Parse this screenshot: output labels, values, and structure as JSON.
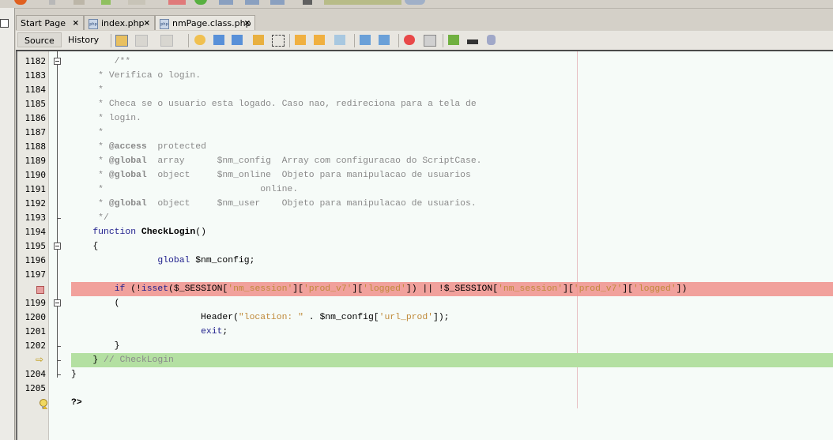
{
  "tabs": [
    {
      "label": "Start Page",
      "close": "×",
      "has_icon": false
    },
    {
      "label": "index.php",
      "close": "×",
      "has_icon": true
    },
    {
      "label": "nmPage.class.php",
      "close": "×",
      "has_icon": true,
      "active": true
    }
  ],
  "php_icon_text": "php",
  "editor_toolbar": {
    "source_label": "Source",
    "history_label": "History",
    "icons": [
      "last-edit-icon",
      "back-icon",
      "forward-icon",
      "find-selection-icon",
      "find-previous-icon",
      "find-next-icon",
      "toggle-highlight-icon",
      "toggle-rect-selection-icon",
      "previous-bookmark-icon",
      "next-bookmark-icon",
      "toggle-bookmark-icon",
      "shift-left-icon",
      "shift-right-icon",
      "start-macro-icon",
      "stop-macro-icon",
      "comment-icon",
      "uncomment-icon",
      "database-icon"
    ]
  },
  "lines": [
    {
      "num": "1182",
      "marker": "",
      "tokens": [
        {
          "t": "        /**",
          "c": "cm"
        }
      ]
    },
    {
      "num": "1183",
      "marker": "",
      "tokens": [
        {
          "t": "     * Verifica o login.",
          "c": "cm"
        }
      ]
    },
    {
      "num": "1184",
      "marker": "",
      "tokens": [
        {
          "t": "     *",
          "c": "cm"
        }
      ]
    },
    {
      "num": "1185",
      "marker": "",
      "tokens": [
        {
          "t": "     * Checa se o usuario esta logado. Caso nao, redireciona para a tela de",
          "c": "cm"
        }
      ]
    },
    {
      "num": "1186",
      "marker": "",
      "tokens": [
        {
          "t": "     * login.",
          "c": "cm"
        }
      ]
    },
    {
      "num": "1187",
      "marker": "",
      "tokens": [
        {
          "t": "     *",
          "c": "cm"
        }
      ]
    },
    {
      "num": "1188",
      "marker": "",
      "tokens": [
        {
          "t": "     * ",
          "c": "cm"
        },
        {
          "t": "@access",
          "c": "cmb"
        },
        {
          "t": "  protected",
          "c": "cm"
        }
      ]
    },
    {
      "num": "1189",
      "marker": "",
      "tokens": [
        {
          "t": "     * ",
          "c": "cm"
        },
        {
          "t": "@global",
          "c": "cmb"
        },
        {
          "t": "  array      $nm_config  Array com configuracao do ScriptCase.",
          "c": "cm"
        }
      ]
    },
    {
      "num": "1190",
      "marker": "",
      "tokens": [
        {
          "t": "     * ",
          "c": "cm"
        },
        {
          "t": "@global",
          "c": "cmb"
        },
        {
          "t": "  object     $nm_online  Objeto para manipulacao de usuarios",
          "c": "cm"
        }
      ]
    },
    {
      "num": "1191",
      "marker": "",
      "tokens": [
        {
          "t": "     *                             online.",
          "c": "cm"
        }
      ]
    },
    {
      "num": "1192",
      "marker": "",
      "tokens": [
        {
          "t": "     * ",
          "c": "cm"
        },
        {
          "t": "@global",
          "c": "cmb"
        },
        {
          "t": "  object     $nm_user    Objeto para manipulacao de usuarios.",
          "c": "cm"
        }
      ]
    },
    {
      "num": "1193",
      "marker": "",
      "tokens": [
        {
          "t": "     */",
          "c": "cm"
        }
      ]
    },
    {
      "num": "1194",
      "marker": "",
      "tokens": [
        {
          "t": "    ",
          "c": ""
        },
        {
          "t": "function",
          "c": "kw"
        },
        {
          "t": " ",
          "c": ""
        },
        {
          "t": "CheckLogin",
          "c": "fn"
        },
        {
          "t": "()",
          "c": ""
        }
      ]
    },
    {
      "num": "1195",
      "marker": "",
      "tokens": [
        {
          "t": "    {",
          "c": ""
        }
      ]
    },
    {
      "num": "1196",
      "marker": "",
      "tokens": [
        {
          "t": "                ",
          "c": ""
        },
        {
          "t": "global",
          "c": "kw"
        },
        {
          "t": " $nm_config;",
          "c": "var"
        }
      ]
    },
    {
      "num": "1197",
      "marker": "",
      "tokens": [
        {
          "t": "",
          "c": ""
        }
      ]
    },
    {
      "num": "",
      "marker": "breakpoint",
      "tokens": [
        {
          "t": "        ",
          "c": ""
        },
        {
          "t": "if",
          "c": "kw"
        },
        {
          "t": " (!",
          "c": ""
        },
        {
          "t": "isset",
          "c": "kw"
        },
        {
          "t": "($_SESSION[",
          "c": ""
        },
        {
          "t": "'nm_session'",
          "c": "str"
        },
        {
          "t": "][",
          "c": ""
        },
        {
          "t": "'prod_v7'",
          "c": "str"
        },
        {
          "t": "][",
          "c": ""
        },
        {
          "t": "'logged'",
          "c": "str"
        },
        {
          "t": "]) || !$_SESSION[",
          "c": ""
        },
        {
          "t": "'nm_session'",
          "c": "str"
        },
        {
          "t": "][",
          "c": ""
        },
        {
          "t": "'prod_v7'",
          "c": "str"
        },
        {
          "t": "][",
          "c": ""
        },
        {
          "t": "'logged'",
          "c": "str"
        },
        {
          "t": "])",
          "c": ""
        }
      ]
    },
    {
      "num": "1199",
      "marker": "",
      "tokens": [
        {
          "t": "        (",
          "c": ""
        }
      ]
    },
    {
      "num": "1200",
      "marker": "",
      "tokens": [
        {
          "t": "                        Header(",
          "c": ""
        },
        {
          "t": "\"location: \"",
          "c": "str"
        },
        {
          "t": " . $nm_config[",
          "c": ""
        },
        {
          "t": "'url_prod'",
          "c": "str"
        },
        {
          "t": "]);",
          "c": ""
        }
      ]
    },
    {
      "num": "1201",
      "marker": "",
      "tokens": [
        {
          "t": "                        ",
          "c": ""
        },
        {
          "t": "exit",
          "c": "kw"
        },
        {
          "t": ";",
          "c": ""
        }
      ]
    },
    {
      "num": "1202",
      "marker": "",
      "tokens": [
        {
          "t": "        }",
          "c": ""
        }
      ]
    },
    {
      "num": "",
      "marker": "current",
      "tokens": [
        {
          "t": "    } ",
          "c": ""
        },
        {
          "t": "// CheckLogin",
          "c": "cm"
        }
      ]
    },
    {
      "num": "1204",
      "marker": "",
      "tokens": [
        {
          "t": "}",
          "c": ""
        }
      ]
    },
    {
      "num": "1205",
      "marker": "",
      "tokens": [
        {
          "t": "",
          "c": ""
        }
      ]
    },
    {
      "num": "",
      "marker": "hint",
      "tokens": [
        {
          "t": "?>",
          "c": "ph"
        }
      ]
    }
  ]
}
